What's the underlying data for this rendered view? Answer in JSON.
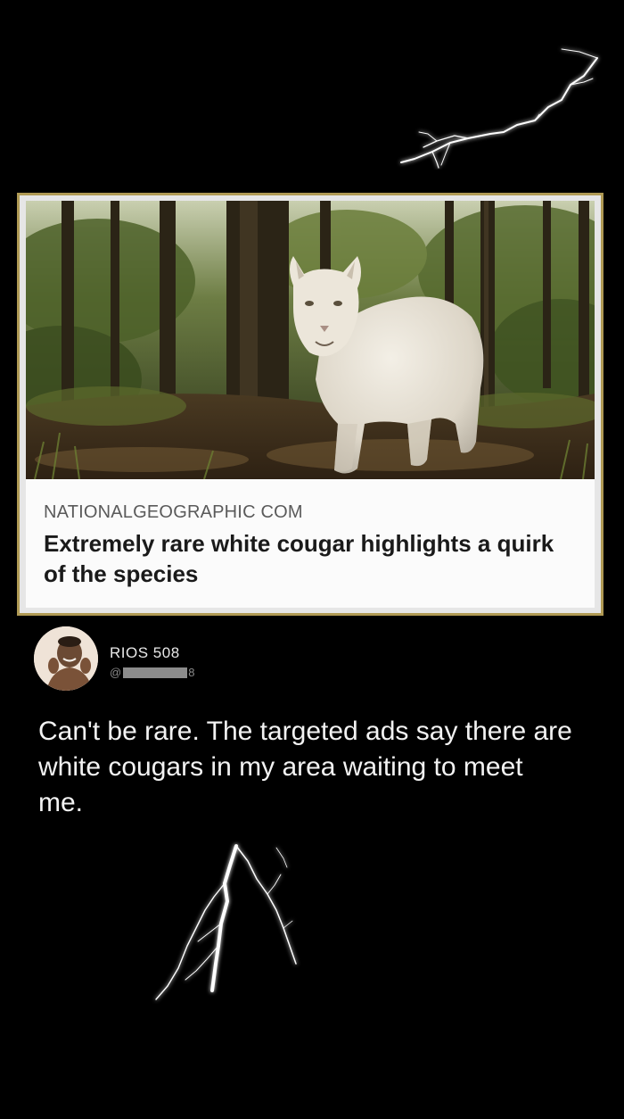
{
  "article": {
    "source": "NATIONALGEOGRAPHIC COM",
    "title": "Extremely rare white cougar highlights a quirk of the species",
    "image": "white-cougar-forest-photo"
  },
  "tweet": {
    "display_name": "RIOS 508",
    "handle_prefix": "@",
    "handle_tail": "8",
    "text": "Can't be rare. The targeted ads say there are white cougars in my area waiting to meet me."
  },
  "colors": {
    "background": "#000000",
    "card_border": "#b09a54",
    "card_background": "#fbfbfb",
    "tweet_text": "#f2f2f2",
    "handle_text": "#8a8a8a"
  }
}
